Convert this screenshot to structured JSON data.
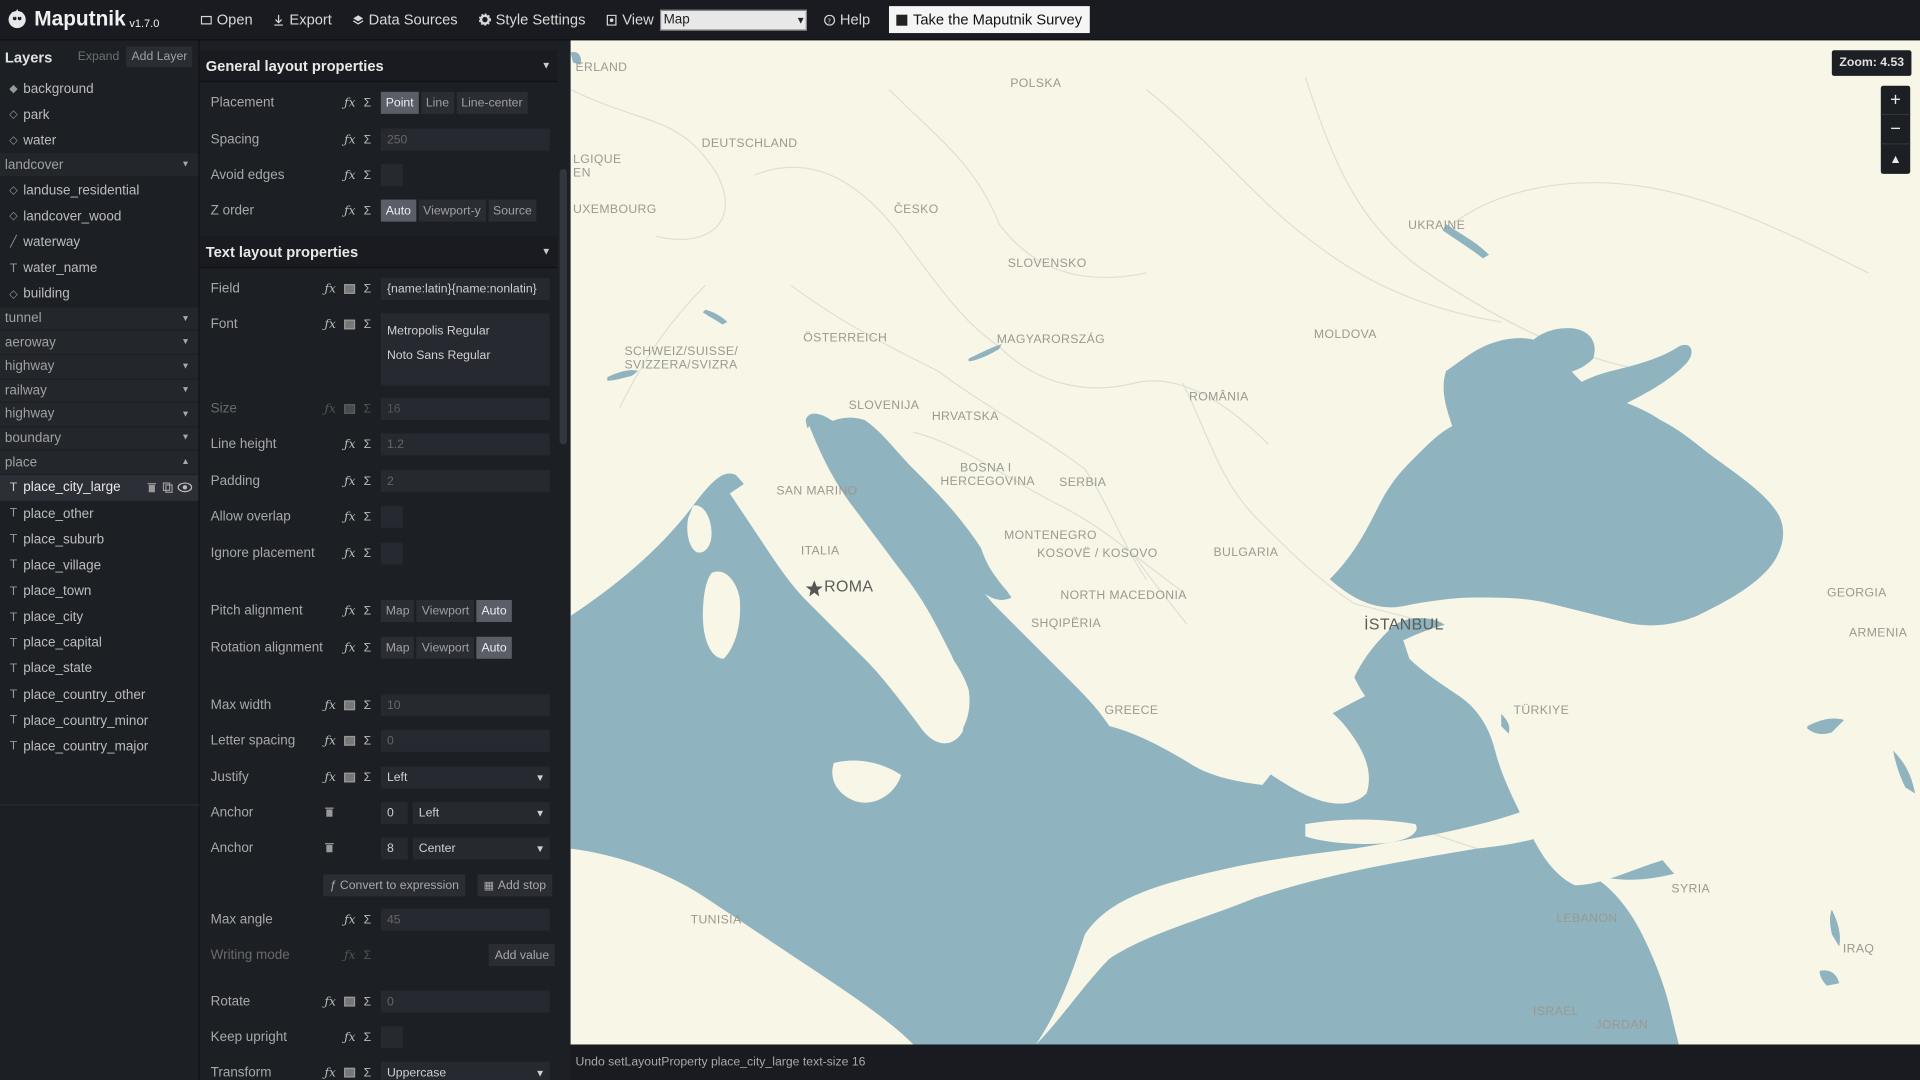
{
  "app": {
    "name": "Maputnik",
    "version": "v1.7.0"
  },
  "toolbar": {
    "open": "Open",
    "export": "Export",
    "data_sources": "Data Sources",
    "style_settings": "Style Settings",
    "view": "View",
    "view_value": "Map",
    "help": "Help",
    "survey": "Take the Maputnik Survey"
  },
  "layers": {
    "title": "Layers",
    "expand": "Expand",
    "add": "Add Layer",
    "top_items": [
      {
        "label": "background",
        "icon": "diamond-filled-icon"
      },
      {
        "label": "park",
        "icon": "diamond-outline-icon"
      },
      {
        "label": "water",
        "icon": "diamond-outline-icon"
      }
    ],
    "group_landcover": "landcover",
    "landcover_items": [
      {
        "label": "landuse_residential",
        "icon": "diamond-outline-icon"
      },
      {
        "label": "landcover_wood",
        "icon": "diamond-outline-icon"
      },
      {
        "label": "waterway",
        "icon": "line-icon"
      },
      {
        "label": "water_name",
        "icon": "text-icon"
      },
      {
        "label": "building",
        "icon": "diamond-outline-icon"
      }
    ],
    "groups": [
      "tunnel",
      "aeroway",
      "highway",
      "railway",
      "highway",
      "boundary",
      "place"
    ],
    "place_items": [
      "place_city_large",
      "place_other",
      "place_suburb",
      "place_village",
      "place_town",
      "place_city",
      "place_capital",
      "place_state",
      "place_country_other",
      "place_country_minor",
      "place_country_major"
    ]
  },
  "editor": {
    "general_title": "General layout properties",
    "text_title": "Text layout properties",
    "placement": {
      "label": "Placement",
      "options": [
        "Point",
        "Line",
        "Line-center"
      ],
      "active": "Point"
    },
    "spacing": {
      "label": "Spacing",
      "value": "250"
    },
    "avoid_edges": {
      "label": "Avoid edges"
    },
    "z_order": {
      "label": "Z order",
      "options": [
        "Auto",
        "Viewport-y",
        "Source"
      ],
      "active": "Auto"
    },
    "field": {
      "label": "Field",
      "value": "{name:latin}{name:nonlatin}"
    },
    "font": {
      "label": "Font",
      "values": [
        "Metropolis Regular",
        "Noto Sans Regular"
      ]
    },
    "size": {
      "label": "Size",
      "value": "16"
    },
    "line_height": {
      "label": "Line height",
      "value": "1.2"
    },
    "padding": {
      "label": "Padding",
      "value": "2"
    },
    "allow_overlap": {
      "label": "Allow overlap"
    },
    "ignore_placement": {
      "label": "Ignore placement"
    },
    "pitch_alignment": {
      "label": "Pitch alignment",
      "options": [
        "Map",
        "Viewport",
        "Auto"
      ],
      "active": "Auto"
    },
    "rotation_alignment": {
      "label": "Rotation alignment",
      "options": [
        "Map",
        "Viewport",
        "Auto"
      ],
      "active": "Auto"
    },
    "max_width": {
      "label": "Max width",
      "value": "10"
    },
    "letter_spacing": {
      "label": "Letter spacing",
      "value": "0"
    },
    "justify": {
      "label": "Justify",
      "value": "Left"
    },
    "anchor1": {
      "label": "Anchor",
      "num": "0",
      "value": "Left"
    },
    "anchor2": {
      "label": "Anchor",
      "num": "8",
      "value": "Center"
    },
    "convert": "Convert to expression",
    "add_stop": "Add stop",
    "max_angle": {
      "label": "Max angle",
      "value": "45"
    },
    "writing_mode": {
      "label": "Writing mode",
      "add_value": "Add value"
    },
    "rotate": {
      "label": "Rotate",
      "value": "0"
    },
    "keep_upright": {
      "label": "Keep upright"
    },
    "transform": {
      "label": "Transform",
      "value": "Uppercase"
    },
    "icons": {
      "fx": "ƒx",
      "sigma": "Σ"
    }
  },
  "map": {
    "zoom": "Zoom: 4.53",
    "labels": {
      "nerland": "ERLAND",
      "polska": "POLSKA",
      "deutschland": "DEUTSCHLAND",
      "lgique": "LGIQUE",
      "en": "EN",
      "uxembourg": "UXEMBOURG",
      "cesko": "ČESKO",
      "ukraine": "UKRAINE",
      "slovensko": "SLOVENSKO",
      "schweiz": "SCHWEIZ/SUISSE/",
      "svizzera": "SVIZZERA/SVIZRA",
      "osterreich": "ÖSTERREICH",
      "magyarorszag": "MAGYARORSZÁG",
      "moldova": "MOLDOVA",
      "slovenija": "SLOVENIJA",
      "hrvatska": "HRVATSKA",
      "romania": "ROMÂNIA",
      "bosna1": "BOSNA I",
      "bosna2": "HERCEGOVINA",
      "serbia": "SERBIA",
      "san_marino": "SAN MARINO",
      "italia": "ITALIA",
      "montenegro": "MONTENEGRO",
      "kosove": "KOSOVË / KOSOVO",
      "bulgaria": "BULGARIA",
      "roma": "ROMA",
      "north_macedonia": "NORTH MACEDONIA",
      "shqiperia": "SHQIPËRIA",
      "istanbul": "İSTANBUL",
      "georgia": "GEORGIA",
      "armenia": "ARMENIA",
      "greece": "GREECE",
      "turkiye": "TÜRKIYE",
      "tunisia": "TUNISIA",
      "syria": "SYRIA",
      "lebanon": "LEBANON",
      "iraq": "IRAQ",
      "israel": "ISRAEL",
      "jordan": "JORDAN"
    },
    "colors": {
      "land": "#f7f6e7",
      "water": "#8fb3bf",
      "border": "#d9d9d2"
    }
  },
  "status": "Undo setLayoutProperty place_city_large text-size 16"
}
